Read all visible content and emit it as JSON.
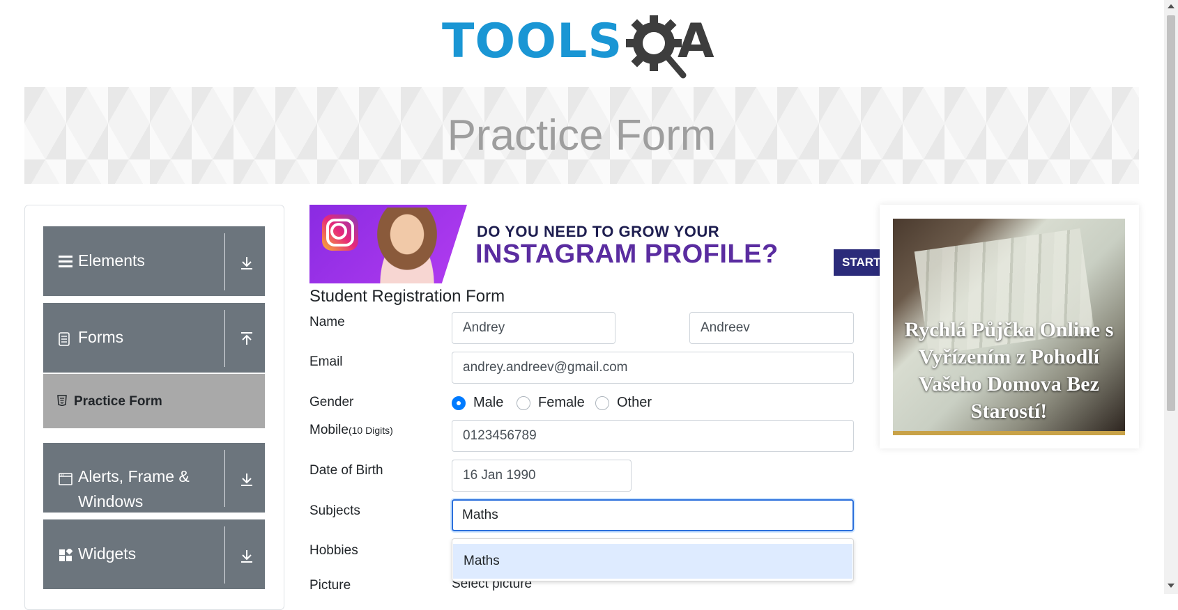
{
  "logo": {
    "text_tools": "TOOLS",
    "text_a": "A"
  },
  "banner": {
    "title": "Practice Form"
  },
  "sidebar": {
    "groups": [
      {
        "label": "Elements",
        "icon": "menu-icon",
        "arrow": "download-icon"
      },
      {
        "label": "Forms",
        "icon": "document-icon",
        "arrow": "upload-icon"
      },
      {
        "label": "Alerts, Frame & Windows",
        "icon": "window-icon",
        "arrow": "download-icon"
      },
      {
        "label": "Widgets",
        "icon": "widgets-icon",
        "arrow": "download-icon"
      }
    ],
    "active_item": {
      "label": "Practice Form",
      "icon": "html5-icon"
    }
  },
  "ad_top": {
    "line1": "DO YOU NEED TO GROW YOUR",
    "line2": "INSTAGRAM PROFILE?",
    "button": "START"
  },
  "form": {
    "title": "Student Registration Form",
    "name_label": "Name",
    "first_name": "Andrey",
    "last_name": "Andreev",
    "email_label": "Email",
    "email": "andrey.andreev@gmail.com",
    "gender_label": "Gender",
    "gender_options": [
      "Male",
      "Female",
      "Other"
    ],
    "gender_selected": "Male",
    "mobile_label": "Mobile",
    "mobile_hint": "(10 Digits)",
    "mobile": "0123456789",
    "dob_label": "Date of Birth",
    "dob": "16 Jan 1990",
    "subjects_label": "Subjects",
    "subjects_value": "Maths",
    "subjects_option": "Maths",
    "hobbies_label": "Hobbies",
    "picture_label": "Picture",
    "picture_select": "Select picture"
  },
  "ad_right": {
    "caption": "Rychlá Půjčka Online s Vyřízením z Pohodlí Vašeho Domova Bez Starostí!"
  },
  "colors": {
    "accent": "#007bff",
    "sidebar": "#6c757d",
    "active": "#a9a9a9",
    "logo_blue": "#1a96d4"
  }
}
